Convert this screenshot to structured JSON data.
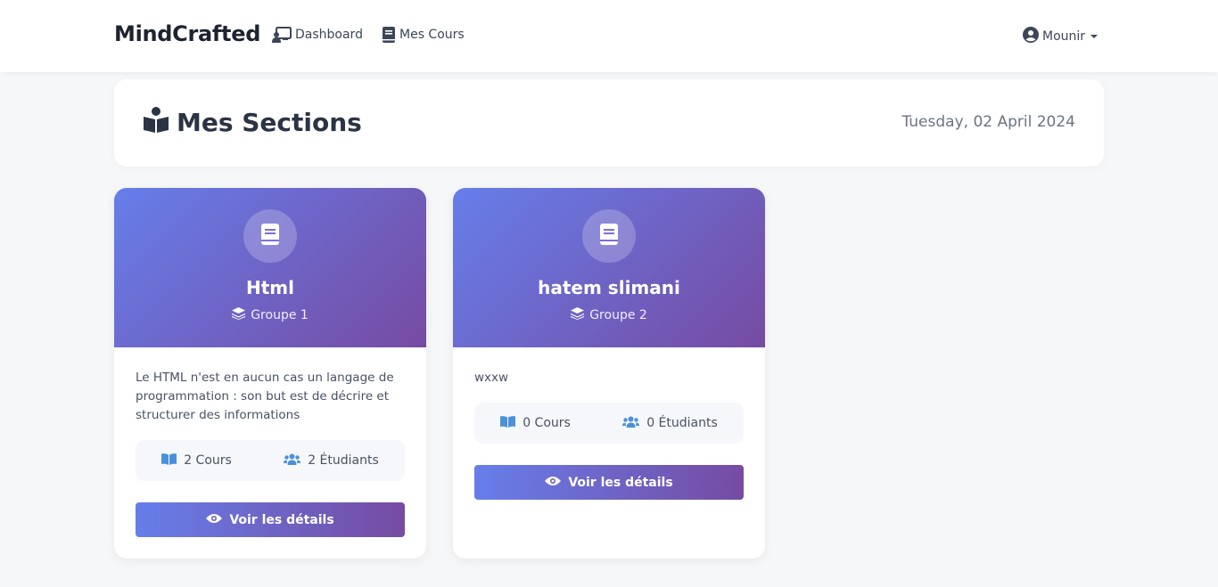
{
  "navbar": {
    "brand": "MindCrafted",
    "links": [
      {
        "label": "Dashboard",
        "icon": "chalkboard-teacher-icon"
      },
      {
        "label": "Mes Cours",
        "icon": "book-icon"
      }
    ],
    "user": {
      "name": "Mounir",
      "icon": "user-circle-icon"
    }
  },
  "header": {
    "title": "Mes Sections",
    "icon": "book-reader-icon",
    "date": "Tuesday, 02 April 2024"
  },
  "sections": [
    {
      "title": "Html",
      "group": "Groupe 1",
      "description": "Le HTML n'est en aucun cas un langage de programmation : son but est de décrire et structurer des informations",
      "courses": "2 Cours",
      "students": "2 Étudiants",
      "button_label": "Voir les détails"
    },
    {
      "title": "hatem slimani",
      "group": "Groupe 2",
      "description": "wxxw",
      "courses": "0 Cours",
      "students": "0 Étudiants",
      "button_label": "Voir les détails"
    }
  ],
  "colors": {
    "gradient_start": "#667eea",
    "gradient_end": "#764ba2",
    "stat_icon": "#4a90d9",
    "background": "#f6f7f9"
  }
}
